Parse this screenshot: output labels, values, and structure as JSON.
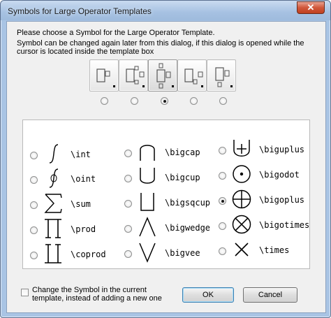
{
  "window": {
    "title": "Symbols for Large Operator Templates",
    "close_glyph": "✕"
  },
  "text": {
    "prompt": "Please choose a Symbol for the Large Operator Template.",
    "note": "Symbol can be changed again later from this dialog, if this dialog is opened while the cursor is located inside the template box"
  },
  "template_variants": {
    "selected_index": 2,
    "count": 5
  },
  "symbols": [
    {
      "label": "\\int",
      "icon": "integral-icon",
      "checked": false
    },
    {
      "label": "\\oint",
      "icon": "contour-integral-icon",
      "checked": false
    },
    {
      "label": "\\sum",
      "icon": "sum-icon",
      "checked": false
    },
    {
      "label": "\\prod",
      "icon": "product-icon",
      "checked": false
    },
    {
      "label": "\\coprod",
      "icon": "coproduct-icon",
      "checked": false
    },
    {
      "label": "\\bigcap",
      "icon": "big-intersection-icon",
      "checked": false
    },
    {
      "label": "\\bigcup",
      "icon": "big-union-icon",
      "checked": false
    },
    {
      "label": "\\bigsqcup",
      "icon": "big-square-union-icon",
      "checked": false
    },
    {
      "label": "\\bigwedge",
      "icon": "big-wedge-icon",
      "checked": false
    },
    {
      "label": "\\bigvee",
      "icon": "big-vee-icon",
      "checked": false
    },
    {
      "label": "\\biguplus",
      "icon": "big-uplus-icon",
      "checked": false
    },
    {
      "label": "\\bigodot",
      "icon": "big-odot-icon",
      "checked": false
    },
    {
      "label": "\\bigoplus",
      "icon": "big-oplus-icon",
      "checked": true
    },
    {
      "label": "\\bigotimes",
      "icon": "big-otimes-icon",
      "checked": false
    },
    {
      "label": "\\times",
      "icon": "times-icon",
      "checked": false
    }
  ],
  "change_option": {
    "label": "Change the Symbol in the current template, instead of adding a new one",
    "checked": false
  },
  "buttons": {
    "ok": "OK",
    "cancel": "Cancel"
  }
}
